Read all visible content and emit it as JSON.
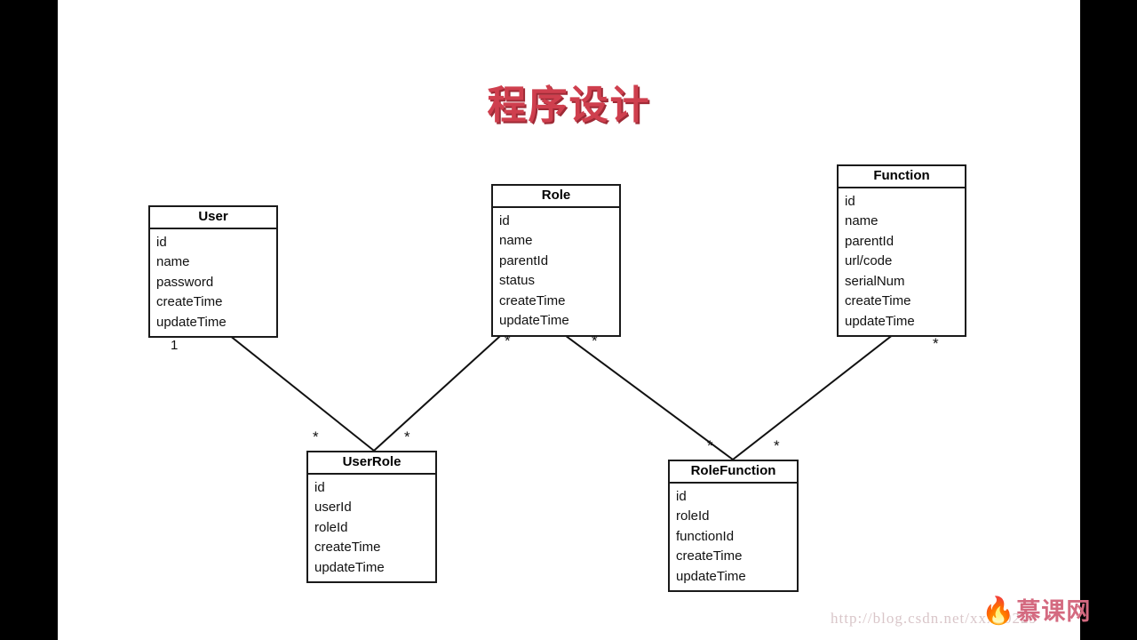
{
  "title": "程序设计",
  "theme": {
    "title_color": "#cf3f4e",
    "title_shadow_color": "#9e2a36",
    "line_color": "#111111",
    "box_border_color": "#1a1a1a",
    "canvas_background": "#ffffff",
    "letterbox_color": "#000000",
    "watermark_color": "#d9c6c9",
    "logo_color": "#d46a80"
  },
  "entities": [
    {
      "name": "User",
      "fields": [
        "id",
        "name",
        "password",
        "createTime",
        "updateTime"
      ]
    },
    {
      "name": "Role",
      "fields": [
        "id",
        "name",
        "parentId",
        "status",
        "createTime",
        "updateTime"
      ]
    },
    {
      "name": "Function",
      "fields": [
        "id",
        "name",
        "parentId",
        "url/code",
        "serialNum",
        "createTime",
        "updateTime"
      ]
    },
    {
      "name": "UserRole",
      "fields": [
        "id",
        "userId",
        "roleId",
        "createTime",
        "updateTime"
      ]
    },
    {
      "name": "RoleFunction",
      "fields": [
        "id",
        "roleId",
        "functionId",
        "createTime",
        "updateTime"
      ]
    }
  ],
  "multiplicities": [
    {
      "id": "user-end",
      "label": "1"
    },
    {
      "id": "userrole-left-end",
      "label": "*"
    },
    {
      "id": "userrole-right-end",
      "label": "*"
    },
    {
      "id": "role-left-end",
      "label": "*"
    },
    {
      "id": "role-right-end",
      "label": "*"
    },
    {
      "id": "rolefunction-left-end",
      "label": "*"
    },
    {
      "id": "rolefunction-right-end",
      "label": "*"
    },
    {
      "id": "function-end",
      "label": "*"
    }
  ],
  "watermark": {
    "url": "http://blog.csdn.net/xxx10229",
    "logo_text": "慕课网",
    "logo_icon": "flame-icon"
  }
}
